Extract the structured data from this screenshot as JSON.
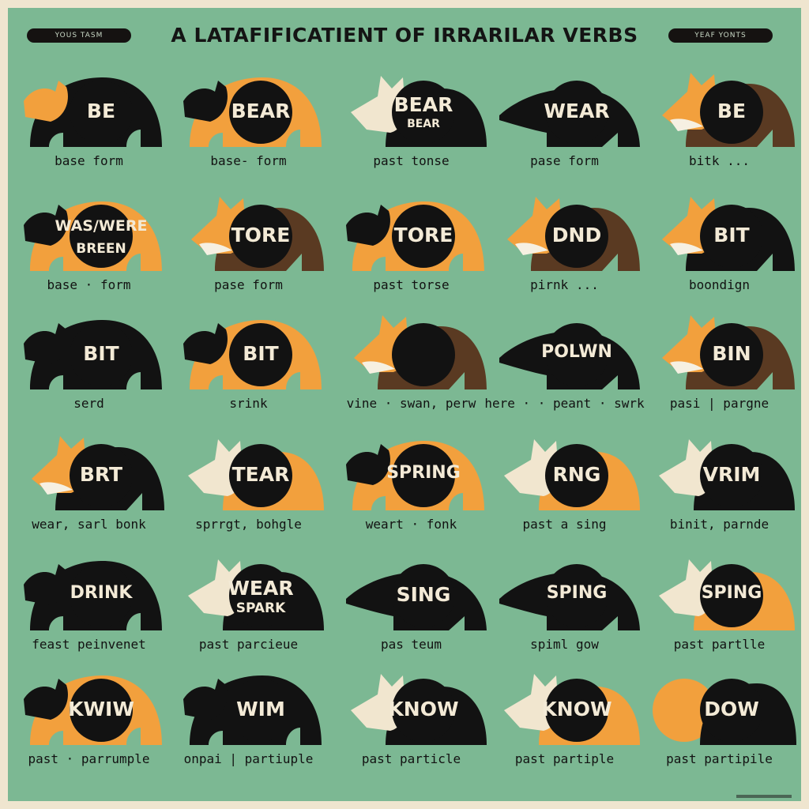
{
  "header": {
    "title": "A LATAFIFICATIENT OF IRRARILAR VERBS",
    "left_pill": "YOUS TASM",
    "right_pill": "YEAF YONTS"
  },
  "colors": {
    "background": "#7cb893",
    "black": "#121212",
    "orange": "#f2a03d",
    "cream": "#f1e6cf",
    "brown": "#5a3a22"
  },
  "rows": [
    {
      "cells": [
        {
          "animal": "bear-icon",
          "word": "BE",
          "caption": "base form"
        },
        {
          "animal": "bear-icon",
          "word": "BEAR",
          "caption": "base- form"
        },
        {
          "animal": "badger-icon",
          "word": "BEAR",
          "sub": "BEAR",
          "caption": "past tonse"
        },
        {
          "animal": "anteater-icon",
          "word": "WEAR",
          "caption": "pase form"
        },
        {
          "animal": "fox-icon",
          "word": "BE",
          "caption": "bitk ..."
        }
      ]
    },
    {
      "cells": [
        {
          "animal": "bear-icon",
          "word": "WAS/WERE",
          "sub": "BREEN",
          "caption": "base · form"
        },
        {
          "animal": "fox-icon",
          "word": "TORE",
          "caption": "pase form"
        },
        {
          "animal": "bear-icon",
          "word": "TORE",
          "caption": "past torse"
        },
        {
          "animal": "fox-icon",
          "word": "DND",
          "caption": "pirnk ..."
        },
        {
          "animal": "fox-icon",
          "word": "BIT",
          "caption": "boondign"
        }
      ]
    },
    {
      "cells": [
        {
          "animal": "bear-icon",
          "word": "BIT",
          "caption": "serd"
        },
        {
          "animal": "bear-icon",
          "word": "BIT",
          "caption": "srink"
        },
        {
          "animal": "fox-icon",
          "word": "",
          "caption": "vine · swan, perw"
        },
        {
          "animal": "anteater-icon",
          "word": "POLWN",
          "caption": "here · · peant · swrk"
        },
        {
          "animal": "fox-icon",
          "word": "BIN",
          "caption": "pasi | pargne"
        }
      ]
    },
    {
      "cells": [
        {
          "animal": "fox-icon",
          "word": "BRT",
          "caption": "wear, sarl bonk"
        },
        {
          "animal": "wolf-icon",
          "word": "TEAR",
          "caption": "sprrgt, bohgle"
        },
        {
          "animal": "bear-icon",
          "word": "SPRING",
          "caption": "weart · fonk"
        },
        {
          "animal": "wolf-icon",
          "word": "RNG",
          "caption": "past a sing"
        },
        {
          "animal": "wolf-icon",
          "word": "VRIM",
          "caption": "binit, parnde"
        }
      ]
    },
    {
      "cells": [
        {
          "animal": "bear-icon",
          "word": "DRINK",
          "caption": "feast peinvenet"
        },
        {
          "animal": "wolf-icon",
          "word": "WEAR",
          "sub": "SPARK",
          "caption": "past parcieue"
        },
        {
          "animal": "anteater-icon",
          "word": "SING",
          "caption": "pas teum"
        },
        {
          "animal": "anteater-icon",
          "word": "SPING",
          "caption": "spiml gow"
        },
        {
          "animal": "wolf-icon",
          "word": "SPING",
          "caption": "past partlle"
        }
      ]
    },
    {
      "cells": [
        {
          "animal": "bear-icon",
          "word": "KWIW",
          "caption": "past · parrumple"
        },
        {
          "animal": "bear-icon",
          "word": "WIM",
          "caption": "onpai | partiuple"
        },
        {
          "animal": "wolf-icon",
          "word": "KNOW",
          "caption": "past particle"
        },
        {
          "animal": "wolf-icon",
          "word": "KNOW",
          "caption": "past partiple"
        },
        {
          "animal": "monkey-icon",
          "word": "DOW",
          "caption": "past partipile"
        }
      ]
    }
  ]
}
